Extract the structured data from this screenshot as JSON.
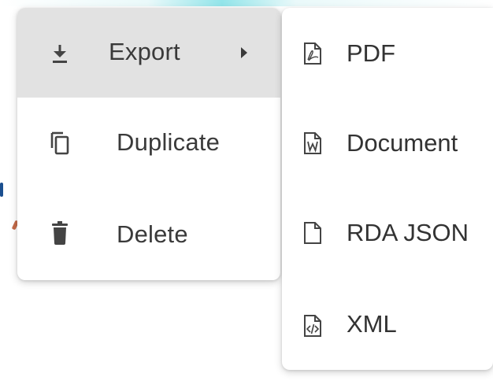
{
  "context_menu": {
    "items": [
      {
        "label": "Export",
        "icon": "download-icon",
        "has_submenu": true,
        "highlighted": true
      },
      {
        "label": "Duplicate",
        "icon": "copy-icon"
      },
      {
        "label": "Delete",
        "icon": "trash-icon"
      }
    ]
  },
  "export_submenu": {
    "items": [
      {
        "label": "PDF",
        "icon": "pdf-file-icon"
      },
      {
        "label": "Document",
        "icon": "word-document-icon"
      },
      {
        "label": "RDA JSON",
        "icon": "blank-file-icon"
      },
      {
        "label": "XML",
        "icon": "code-file-icon"
      }
    ]
  },
  "colors": {
    "highlight": "#e2e2e2",
    "text": "#333333",
    "icon": "#444444"
  }
}
